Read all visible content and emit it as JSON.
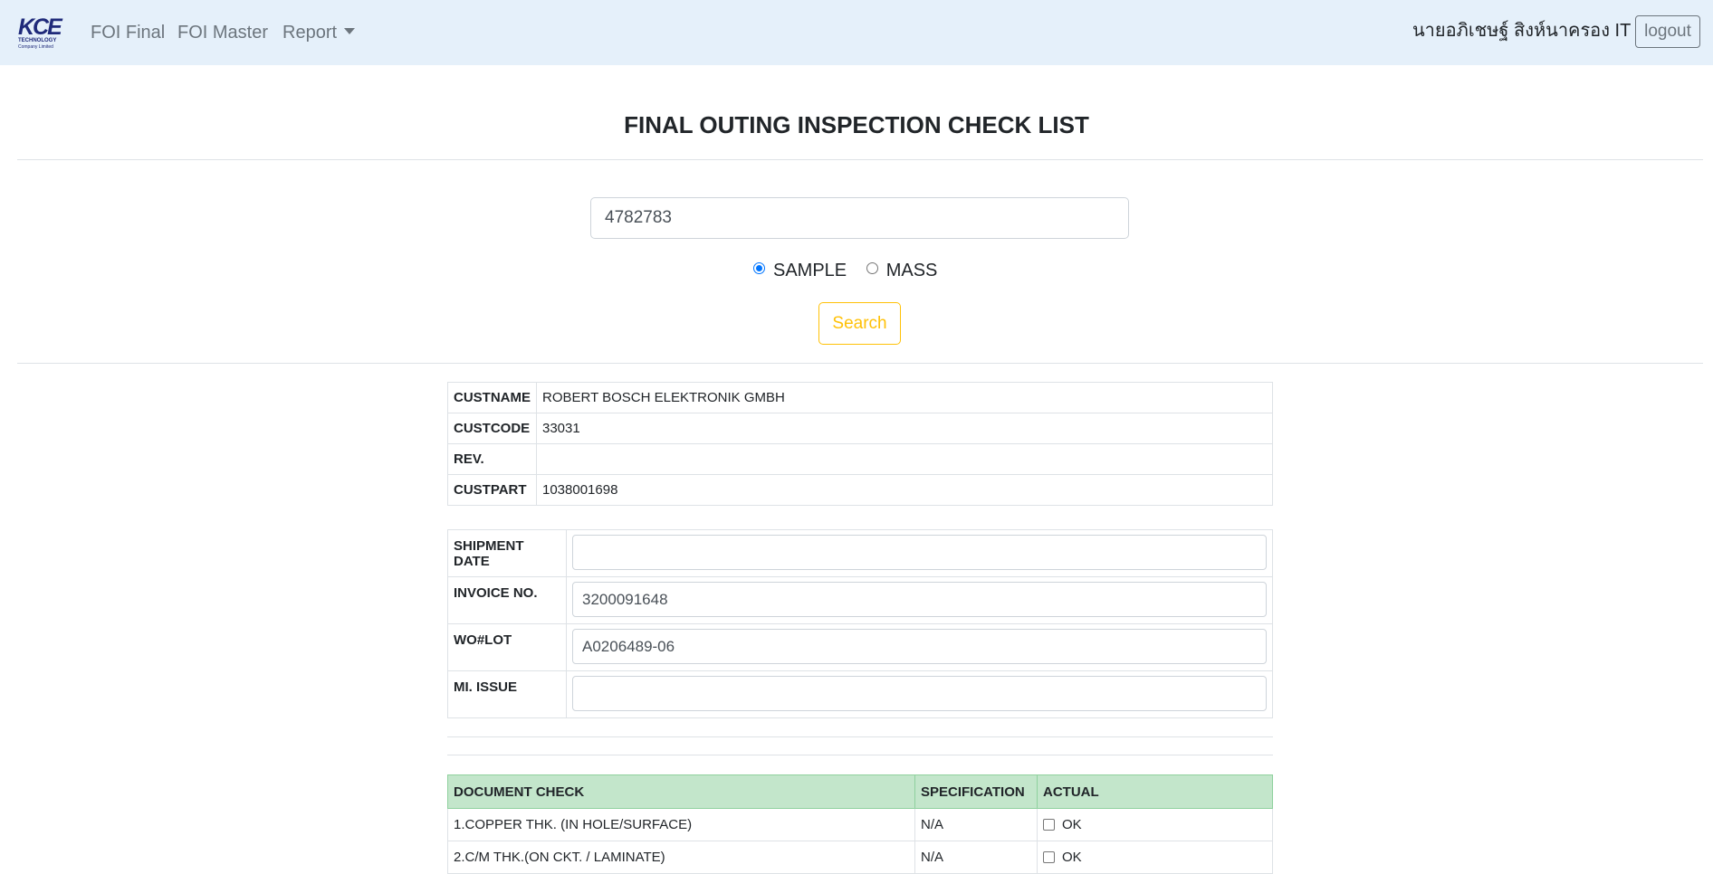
{
  "navbar": {
    "logo": {
      "mark": "KCE",
      "line1": "TECHNOLOGY",
      "line2": "Company Limited"
    },
    "links": [
      "FOI Final",
      "FOI Master",
      "Report"
    ],
    "user_name": "นายอภิเชษฐ์ สิงห์นาครอง IT",
    "logout_label": "logout",
    "background_color": "#e5f0fa"
  },
  "page_title": "FINAL OUTING INSPECTION CHECK LIST",
  "search": {
    "value": "4782783",
    "mode_options": [
      "SAMPLE",
      "MASS"
    ],
    "selected_mode": "SAMPLE",
    "button_label": "Search",
    "button_color": "#ffc107"
  },
  "info": {
    "rows": [
      {
        "label": "CUSTNAME",
        "value": "ROBERT BOSCH ELEKTRONIK GMBH"
      },
      {
        "label": "CUSTCODE",
        "value": "33031"
      },
      {
        "label": "REV.",
        "value": ""
      },
      {
        "label": "CUSTPART",
        "value": "1038001698"
      }
    ]
  },
  "shipment": {
    "rows": [
      {
        "label": "SHIPMENT DATE",
        "value": ""
      },
      {
        "label": "INVOICE NO.",
        "value": "3200091648"
      },
      {
        "label": "WO#LOT",
        "value": "A0206489-06"
      },
      {
        "label": "MI. ISSUE",
        "value": ""
      }
    ]
  },
  "document_check": {
    "header_color": "#c3e6cb",
    "headers": [
      "DOCUMENT CHECK",
      "SPECIFICATION",
      "ACTUAL"
    ],
    "rows": [
      {
        "item": "1.COPPER THK. (IN HOLE/SURFACE)",
        "spec": "N/A",
        "actual_label": "OK",
        "checked": false
      },
      {
        "item": "2.C/M THK.(ON CKT. / LAMINATE)",
        "spec": "N/A",
        "actual_label": "OK",
        "checked": false
      }
    ]
  }
}
